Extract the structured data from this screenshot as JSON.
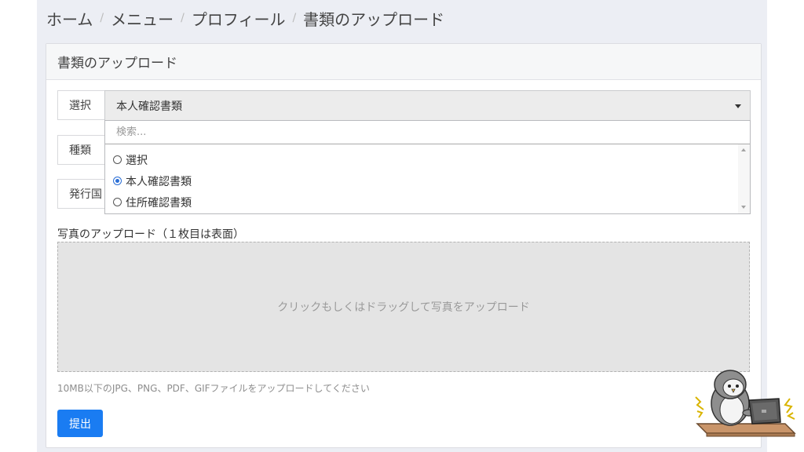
{
  "breadcrumb": {
    "items": [
      "ホーム",
      "メニュー",
      "プロフィール",
      "書類のアップロード"
    ]
  },
  "panel": {
    "title": "書類のアップロード"
  },
  "form": {
    "select_label": "選択",
    "select_value": "本人確認書類",
    "search_placeholder": "検索...",
    "options": [
      {
        "label": "選択",
        "selected": false
      },
      {
        "label": "本人確認書類",
        "selected": true
      },
      {
        "label": "住所確認書類",
        "selected": false
      }
    ],
    "type_label": "種類",
    "country_label": "発行国"
  },
  "upload": {
    "title": "写真のアップロード（１枚目は表面）",
    "dropzone_text": "クリックもしくはドラッグして写真をアップロード",
    "hint": "10MB以下のJPG、PNG、PDF、GIFファイルをアップロードしてください"
  },
  "submit_label": "提出",
  "colors": {
    "accent": "#1a7cf2",
    "page_bg": "#eceef4",
    "dropzone_bg": "#e4e4e4"
  }
}
